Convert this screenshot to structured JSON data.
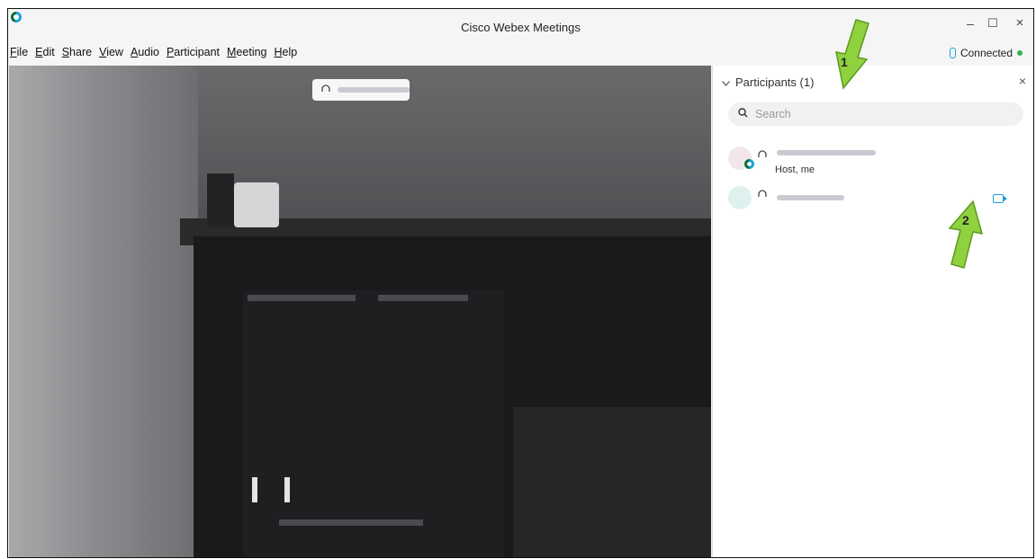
{
  "window": {
    "title": "Cisco Webex Meetings",
    "controls": {
      "minimize": "–",
      "maximize": "☐",
      "close": "×"
    }
  },
  "menu": [
    "File",
    "Edit",
    "Share",
    "View",
    "Audio",
    "Participant",
    "Meeting",
    "Help"
  ],
  "connection": {
    "label": "Connected",
    "status_color": "#2fb35a"
  },
  "participants_panel": {
    "title": "Participants (1)",
    "close_label": "×",
    "search_placeholder": "Search",
    "items": [
      {
        "role_label": "Host, me"
      },
      {
        "role_label": ""
      }
    ]
  },
  "annotations": [
    {
      "label": "1"
    },
    {
      "label": "2"
    }
  ],
  "colors": {
    "accent": "#1aa3d9",
    "arrow": "#8fd13f"
  }
}
